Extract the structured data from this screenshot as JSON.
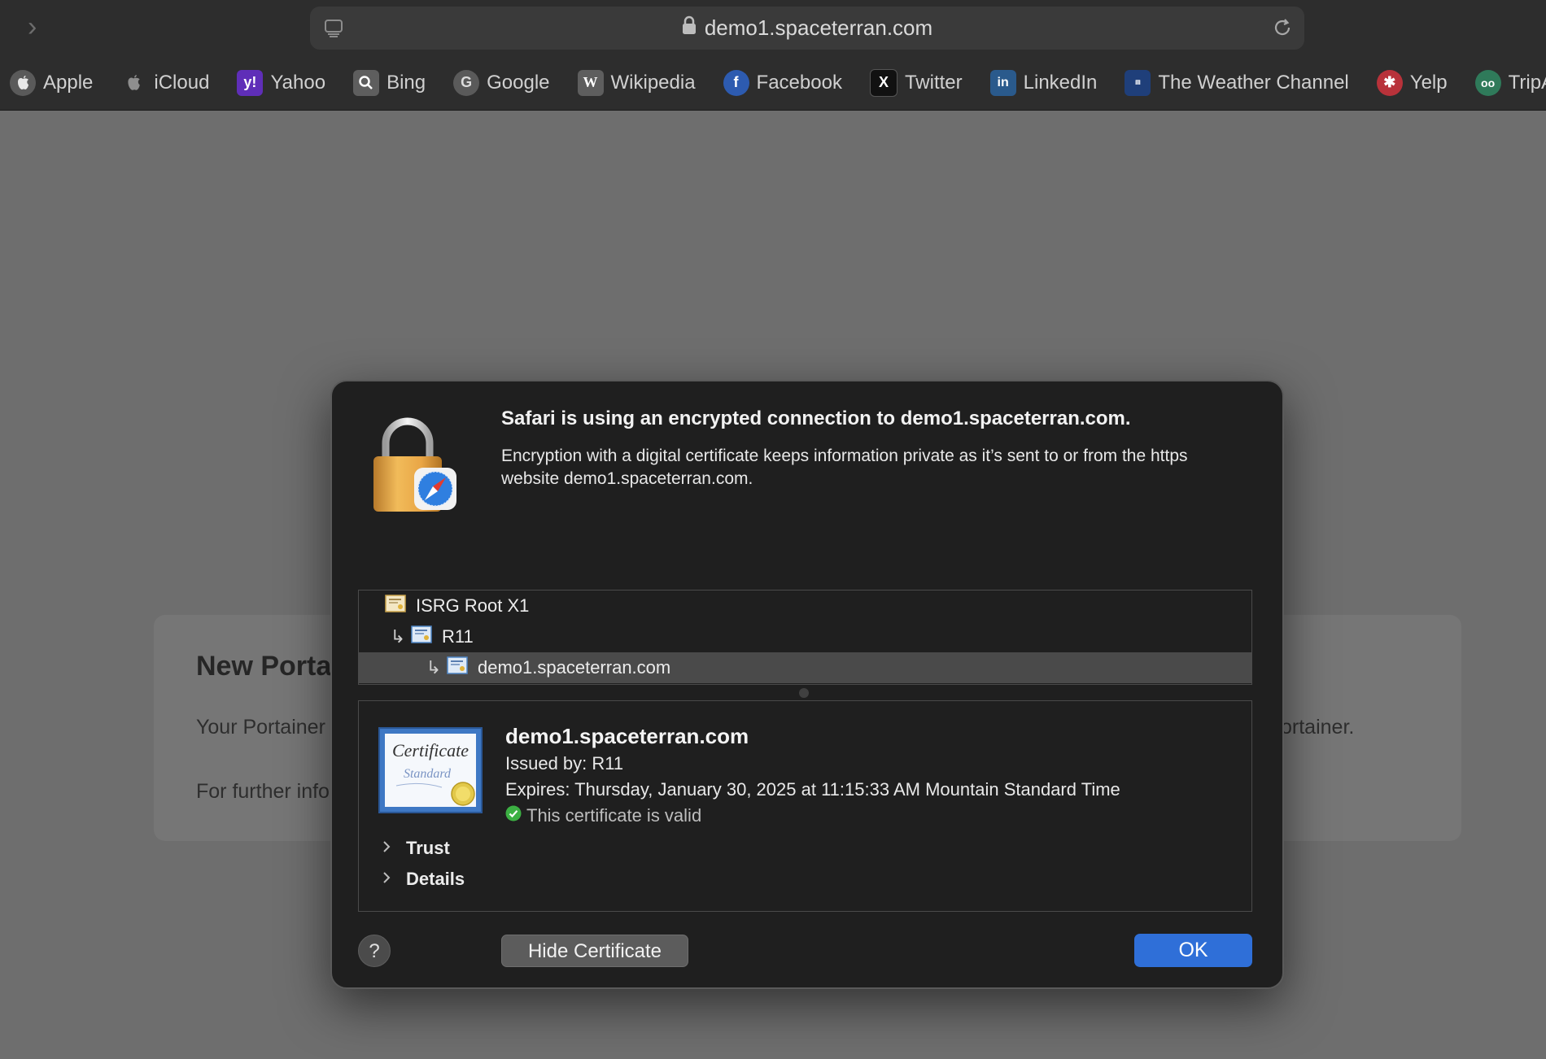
{
  "browser": {
    "url": "demo1.spaceterran.com",
    "bookmarks": [
      {
        "label": "Apple",
        "icon": "apple-icon"
      },
      {
        "label": "iCloud",
        "icon": "apple-icon"
      },
      {
        "label": "Yahoo",
        "icon": "yahoo-icon"
      },
      {
        "label": "Bing",
        "icon": "bing-icon"
      },
      {
        "label": "Google",
        "icon": "google-icon"
      },
      {
        "label": "Wikipedia",
        "icon": "wikipedia-icon"
      },
      {
        "label": "Facebook",
        "icon": "facebook-icon"
      },
      {
        "label": "Twitter",
        "icon": "twitter-icon"
      },
      {
        "label": "LinkedIn",
        "icon": "linkedin-icon"
      },
      {
        "label": "The Weather Channel",
        "icon": "weather-channel-icon"
      },
      {
        "label": "Yelp",
        "icon": "yelp-icon"
      },
      {
        "label": "TripA",
        "icon": "tripadvisor-icon"
      }
    ]
  },
  "page": {
    "card_title": "New Portai",
    "card_text1": "Your Portainer",
    "card_text2": "For further info",
    "card_tail": "ortainer."
  },
  "dialog": {
    "heading": "Safari is using an encrypted connection to demo1.spaceterran.com.",
    "description": "Encryption with a digital certificate keeps information private as it’s sent to or from the https website demo1.spaceterran.com.",
    "chain": [
      {
        "label": "ISRG Root X1"
      },
      {
        "label": "R11"
      },
      {
        "label": "demo1.spaceterran.com"
      }
    ],
    "cert_image_text": {
      "line1": "Certificate",
      "line2": "Standard"
    },
    "detail": {
      "name": "demo1.spaceterran.com",
      "issued_by": "Issued by: R11",
      "expires": "Expires: Thursday, January 30, 2025 at 11:15:33 AM Mountain Standard Time",
      "valid": "This certificate is valid"
    },
    "disclosures": {
      "trust": "Trust",
      "details": "Details"
    },
    "buttons": {
      "help": "?",
      "hide": "Hide Certificate",
      "ok": "OK"
    }
  },
  "colors": {
    "accent": "#2f6fd8",
    "valid_green": "#3cb043"
  }
}
